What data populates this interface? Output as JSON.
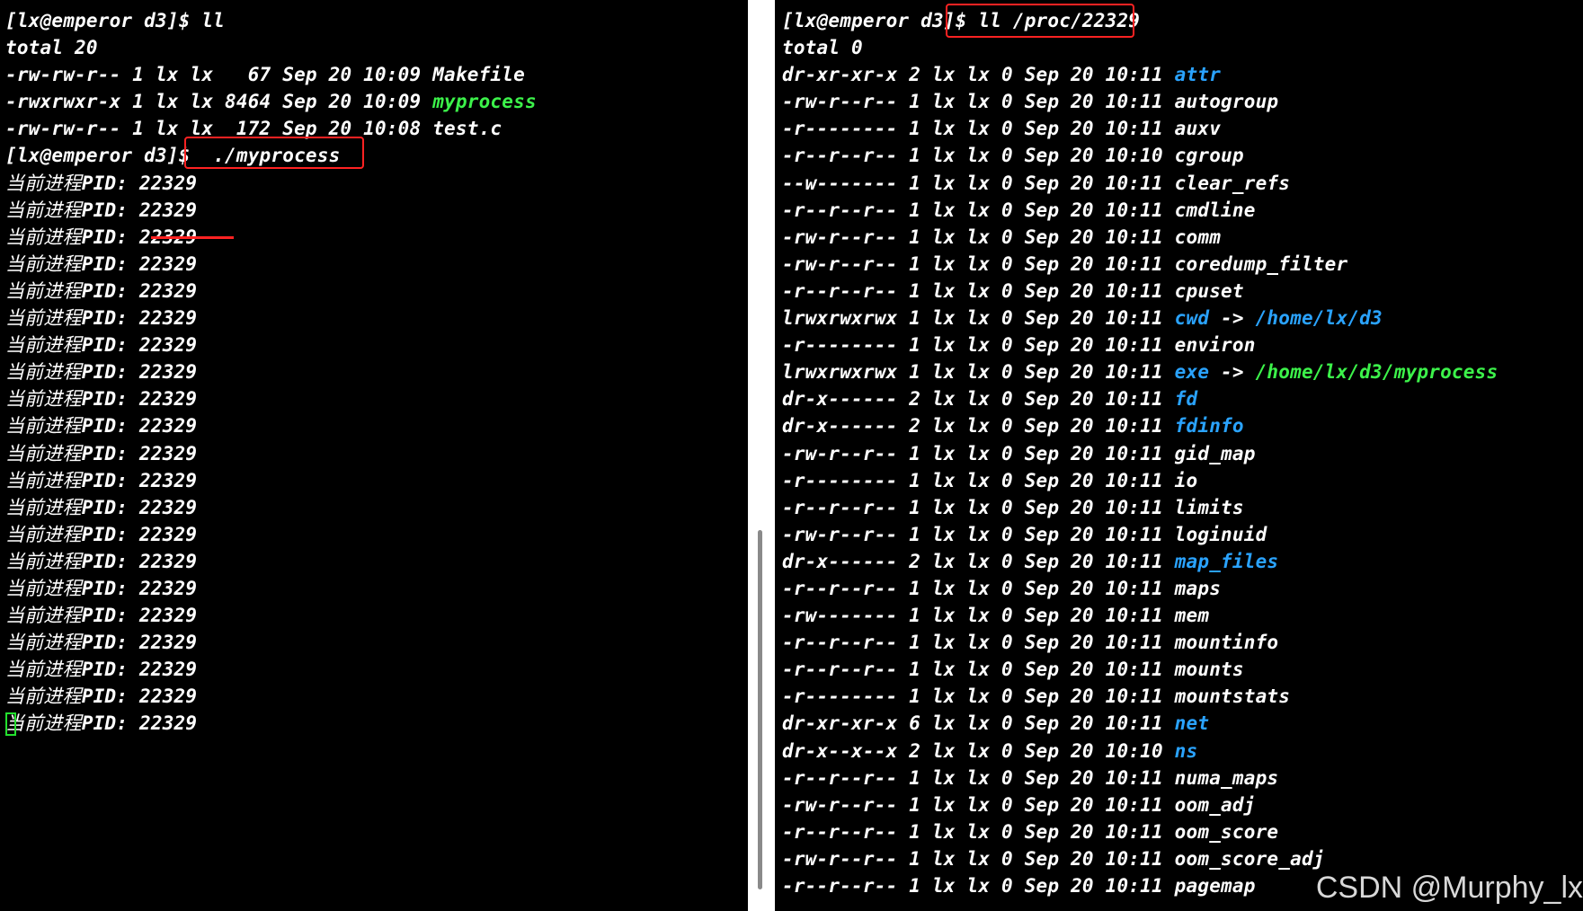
{
  "left_terminal": {
    "prompt_1": "[lx@emperor d3]$ ",
    "command_1": "ll",
    "total": "total 20",
    "files": [
      {
        "meta": "-rw-rw-r-- 1 lx lx   67 Sep 20 10:09 ",
        "name": "Makefile",
        "color": "#ffffff"
      },
      {
        "meta": "-rwxrwxr-x 1 lx lx 8464 Sep 20 10:09 ",
        "name": "myprocess",
        "color": "#3cf24a"
      },
      {
        "meta": "-rw-rw-r-- 1 lx lx  172 Sep 20 10:08 ",
        "name": "test.c",
        "color": "#ffffff"
      }
    ],
    "prompt_2": "[lx@emperor d3]$ ",
    "command_2": "./myprocess",
    "output_label": "当前进程",
    "output_pid_text": "PID: 22329",
    "output_count": 21
  },
  "right_terminal": {
    "prompt": "[lx@emperor d3]$ ",
    "command": "ll /proc/22329",
    "total": "total 0",
    "entries": [
      {
        "meta": "dr-xr-xr-x 2 lx lx 0 Sep 20 10:11 ",
        "name": "attr",
        "type": "dir"
      },
      {
        "meta": "-rw-r--r-- 1 lx lx 0 Sep 20 10:11 ",
        "name": "autogroup",
        "type": "file"
      },
      {
        "meta": "-r-------- 1 lx lx 0 Sep 20 10:11 ",
        "name": "auxv",
        "type": "file"
      },
      {
        "meta": "-r--r--r-- 1 lx lx 0 Sep 20 10:10 ",
        "name": "cgroup",
        "type": "file"
      },
      {
        "meta": "--w------- 1 lx lx 0 Sep 20 10:11 ",
        "name": "clear_refs",
        "type": "file"
      },
      {
        "meta": "-r--r--r-- 1 lx lx 0 Sep 20 10:11 ",
        "name": "cmdline",
        "type": "file"
      },
      {
        "meta": "-rw-r--r-- 1 lx lx 0 Sep 20 10:11 ",
        "name": "comm",
        "type": "file"
      },
      {
        "meta": "-rw-r--r-- 1 lx lx 0 Sep 20 10:11 ",
        "name": "coredump_filter",
        "type": "file"
      },
      {
        "meta": "-r--r--r-- 1 lx lx 0 Sep 20 10:11 ",
        "name": "cpuset",
        "type": "file"
      },
      {
        "meta": "lrwxrwxrwx 1 lx lx 0 Sep 20 10:11 ",
        "name": "cwd",
        "type": "link",
        "target": "/home/lx/d3",
        "target_type": "dir"
      },
      {
        "meta": "-r-------- 1 lx lx 0 Sep 20 10:11 ",
        "name": "environ",
        "type": "file"
      },
      {
        "meta": "lrwxrwxrwx 1 lx lx 0 Sep 20 10:11 ",
        "name": "exe",
        "type": "link",
        "target": "/home/lx/d3/myprocess",
        "target_type": "exec"
      },
      {
        "meta": "dr-x------ 2 lx lx 0 Sep 20 10:11 ",
        "name": "fd",
        "type": "dir"
      },
      {
        "meta": "dr-x------ 2 lx lx 0 Sep 20 10:11 ",
        "name": "fdinfo",
        "type": "dir"
      },
      {
        "meta": "-rw-r--r-- 1 lx lx 0 Sep 20 10:11 ",
        "name": "gid_map",
        "type": "file"
      },
      {
        "meta": "-r-------- 1 lx lx 0 Sep 20 10:11 ",
        "name": "io",
        "type": "file"
      },
      {
        "meta": "-r--r--r-- 1 lx lx 0 Sep 20 10:11 ",
        "name": "limits",
        "type": "file"
      },
      {
        "meta": "-rw-r--r-- 1 lx lx 0 Sep 20 10:11 ",
        "name": "loginuid",
        "type": "file"
      },
      {
        "meta": "dr-x------ 2 lx lx 0 Sep 20 10:11 ",
        "name": "map_files",
        "type": "dir"
      },
      {
        "meta": "-r--r--r-- 1 lx lx 0 Sep 20 10:11 ",
        "name": "maps",
        "type": "file"
      },
      {
        "meta": "-rw------- 1 lx lx 0 Sep 20 10:11 ",
        "name": "mem",
        "type": "file"
      },
      {
        "meta": "-r--r--r-- 1 lx lx 0 Sep 20 10:11 ",
        "name": "mountinfo",
        "type": "file"
      },
      {
        "meta": "-r--r--r-- 1 lx lx 0 Sep 20 10:11 ",
        "name": "mounts",
        "type": "file"
      },
      {
        "meta": "-r-------- 1 lx lx 0 Sep 20 10:11 ",
        "name": "mountstats",
        "type": "file"
      },
      {
        "meta": "dr-xr-xr-x 6 lx lx 0 Sep 20 10:11 ",
        "name": "net",
        "type": "dir"
      },
      {
        "meta": "dr-x--x--x 2 lx lx 0 Sep 20 10:10 ",
        "name": "ns",
        "type": "dir"
      },
      {
        "meta": "-r--r--r-- 1 lx lx 0 Sep 20 10:11 ",
        "name": "numa_maps",
        "type": "file"
      },
      {
        "meta": "-rw-r--r-- 1 lx lx 0 Sep 20 10:11 ",
        "name": "oom_adj",
        "type": "file"
      },
      {
        "meta": "-r--r--r-- 1 lx lx 0 Sep 20 10:11 ",
        "name": "oom_score",
        "type": "file"
      },
      {
        "meta": "-rw-r--r-- 1 lx lx 0 Sep 20 10:11 ",
        "name": "oom_score_adj",
        "type": "file"
      },
      {
        "meta": "-r--r--r-- 1 lx lx 0 Sep 20 10:11 ",
        "name": "pagemap",
        "type": "file"
      }
    ]
  },
  "colors": {
    "background": "#000000",
    "text": "#ffffff",
    "executable": "#3cf24a",
    "directory": "#2aa3ff",
    "annotation_red": "#ff2222"
  },
  "watermark": "CSDN @Murphy_lx"
}
